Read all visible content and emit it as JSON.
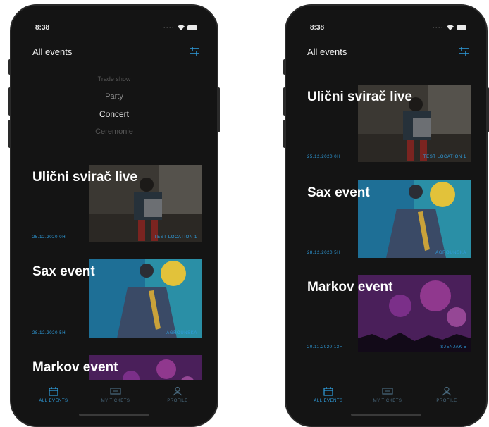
{
  "status_time": "8:38",
  "header": {
    "title": "All events"
  },
  "picker": {
    "items": [
      "Trade show",
      "Party",
      "Concert",
      "Ceremonie"
    ]
  },
  "events": [
    {
      "title": "Ulični svirač live",
      "date": "25.12.2020 0H",
      "location": "TEST LOCATION 1"
    },
    {
      "title": "Sax event",
      "date": "28.12.2020 5H",
      "location": "AGROUNSKA"
    },
    {
      "title": "Markov event",
      "date": "20.11.2020 13H",
      "location": "SJENJAK 5"
    }
  ],
  "tabs": [
    "ALL EVENTS",
    "MY TICKETS",
    "PROFILE"
  ],
  "colors": {
    "accent": "#2f9fe0",
    "background": "#141414"
  },
  "icons": [
    "filter-icon",
    "calendar-icon",
    "ticket-icon",
    "profile-icon",
    "wifi-icon",
    "battery-icon"
  ]
}
